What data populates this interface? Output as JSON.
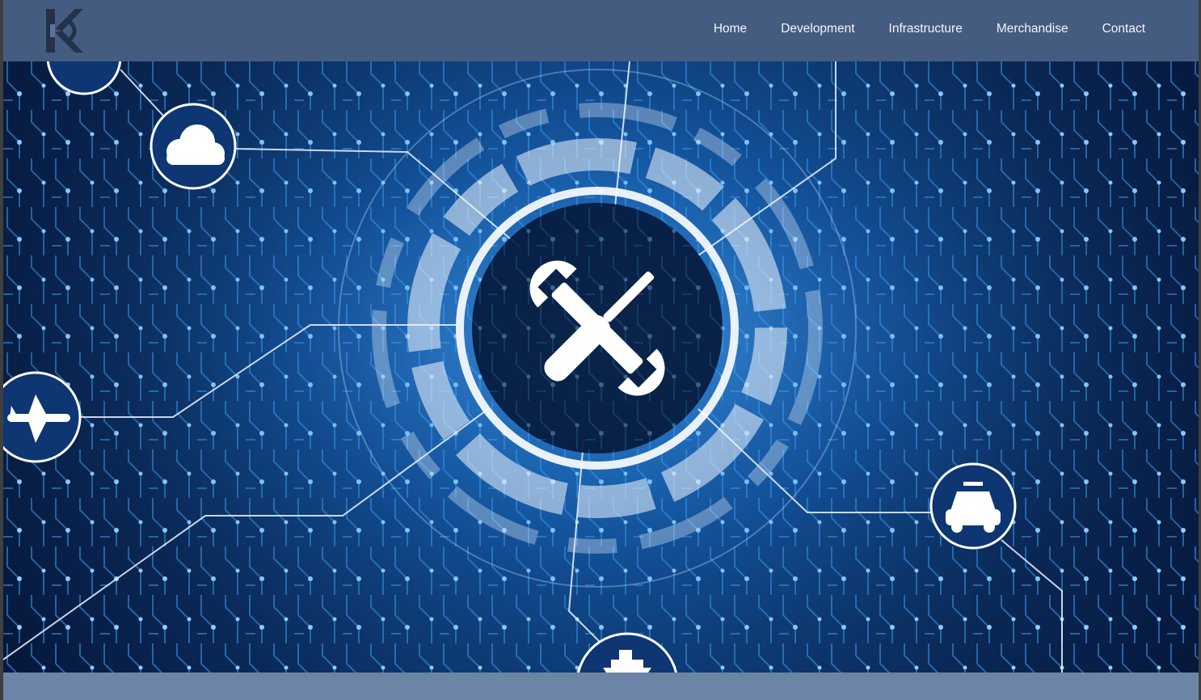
{
  "nav": {
    "items": [
      {
        "label": "Home"
      },
      {
        "label": "Development"
      },
      {
        "label": "Infrastructure"
      },
      {
        "label": "Merchandise"
      },
      {
        "label": "Contact"
      }
    ]
  },
  "logo": {
    "icon": "k-monogram-logo-icon"
  },
  "hero": {
    "icons": [
      "wrench-screwdriver-icon",
      "cloud-icon",
      "airplane-icon",
      "car-icon",
      "ship-icon"
    ]
  },
  "colors": {
    "navbar": "#445c80",
    "footer_strip": "#6c85a6",
    "hero_blue": "#1d6fc2"
  }
}
